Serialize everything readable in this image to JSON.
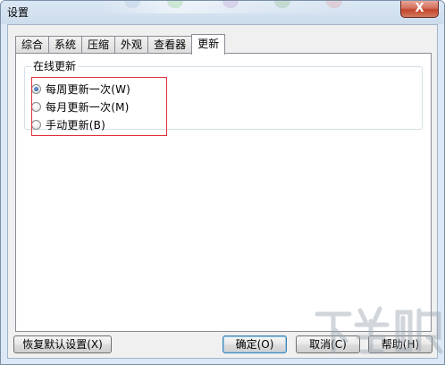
{
  "window": {
    "title": "设置",
    "close_glyph": "X"
  },
  "tabs": [
    {
      "label": "综合",
      "active": false
    },
    {
      "label": "系统",
      "active": false
    },
    {
      "label": "压缩",
      "active": false
    },
    {
      "label": "外观",
      "active": false
    },
    {
      "label": "查看器",
      "active": false
    },
    {
      "label": "更新",
      "active": true
    }
  ],
  "update_panel": {
    "group_title": "在线更新",
    "options": [
      {
        "label": "每周更新一次(W)",
        "checked": true
      },
      {
        "label": "每月更新一次(M)",
        "checked": false
      },
      {
        "label": "手动更新(B)",
        "checked": false
      }
    ]
  },
  "buttons": {
    "restore_defaults": "恢复默认设置(X)",
    "ok": "确定(O)",
    "cancel": "取消(C)",
    "help": "帮助(H)"
  },
  "colors": {
    "highlight_border": "#e0303a",
    "radio_dot": "#2b5ea1",
    "close_button": "#c2442c"
  }
}
